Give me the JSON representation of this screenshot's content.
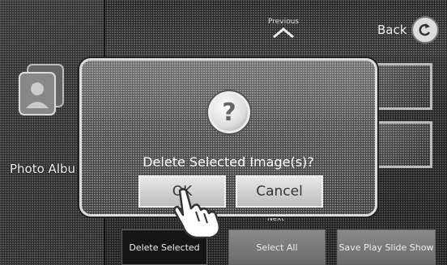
{
  "left_panel": {
    "album_label": "Photo Albu",
    "icon": "photo-album-icon"
  },
  "header": {
    "previous_label": "Previous",
    "back_label": "Back"
  },
  "bottom": {
    "next_label": "Next",
    "delete_label": "Delete Selected",
    "select_all_label": "Select All",
    "slideshow_label": "Save Play Slide Show"
  },
  "dialog": {
    "icon": "question-icon",
    "message": "Delete Selected Image(s)?",
    "ok_label": "OK",
    "cancel_label": "Cancel"
  },
  "colors": {
    "dialog_border": "#dddddd",
    "button_fill": "#d0d0d0"
  }
}
